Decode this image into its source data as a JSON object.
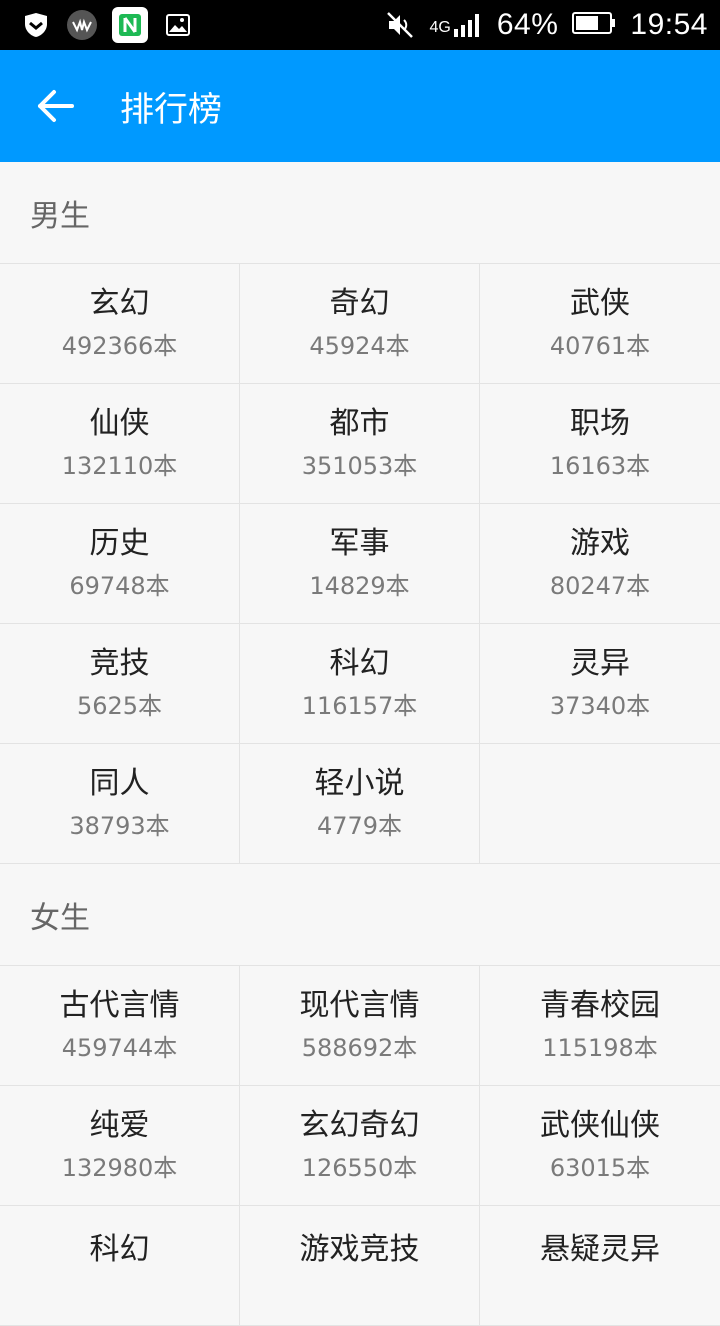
{
  "status_bar": {
    "network": "4G",
    "battery": "64%",
    "time": "19:54"
  },
  "app_bar": {
    "title": "排行榜",
    "back_icon": "arrow-left-icon"
  },
  "sections": [
    {
      "title": "男生",
      "items": [
        {
          "name": "玄幻",
          "count": "492366本"
        },
        {
          "name": "奇幻",
          "count": "45924本"
        },
        {
          "name": "武侠",
          "count": "40761本"
        },
        {
          "name": "仙侠",
          "count": "132110本"
        },
        {
          "name": "都市",
          "count": "351053本"
        },
        {
          "name": "职场",
          "count": "16163本"
        },
        {
          "name": "历史",
          "count": "69748本"
        },
        {
          "name": "军事",
          "count": "14829本"
        },
        {
          "name": "游戏",
          "count": "80247本"
        },
        {
          "name": "竞技",
          "count": "5625本"
        },
        {
          "name": "科幻",
          "count": "116157本"
        },
        {
          "name": "灵异",
          "count": "37340本"
        },
        {
          "name": "同人",
          "count": "38793本"
        },
        {
          "name": "轻小说",
          "count": "4779本"
        }
      ]
    },
    {
      "title": "女生",
      "items": [
        {
          "name": "古代言情",
          "count": "459744本"
        },
        {
          "name": "现代言情",
          "count": "588692本"
        },
        {
          "name": "青春校园",
          "count": "115198本"
        },
        {
          "name": "纯爱",
          "count": "132980本"
        },
        {
          "name": "玄幻奇幻",
          "count": "126550本"
        },
        {
          "name": "武侠仙侠",
          "count": "63015本"
        },
        {
          "name": "科幻",
          "count": ""
        },
        {
          "name": "游戏竞技",
          "count": ""
        },
        {
          "name": "悬疑灵异",
          "count": ""
        }
      ]
    }
  ],
  "colors": {
    "primary": "#0099ff",
    "status_bar": "#000000",
    "background": "#f7f7f7"
  }
}
